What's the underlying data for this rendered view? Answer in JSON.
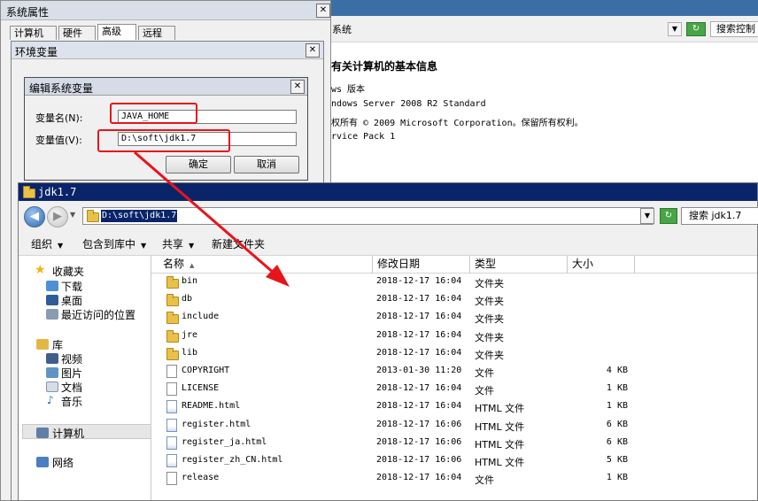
{
  "background_window": {
    "breadcrumb": "▸ 系统",
    "search_placeholder": "搜索控制",
    "heading": "有关计算机的基本信息",
    "edition_label": "ws 版本",
    "os_name": "ndows Server 2008 R2 Standard",
    "copyright": "权所有 © 2009 Microsoft Corporation。保留所有权利。",
    "service_pack": "rvice Pack 1"
  },
  "system_properties": {
    "title": "系统属性",
    "tabs": [
      "计算机名",
      "硬件",
      "高级",
      "远程"
    ],
    "active_tab": "高级"
  },
  "env_vars": {
    "title": "环境变量"
  },
  "edit_dialog": {
    "title": "编辑系统变量",
    "name_label": "变量名(N):",
    "name_value": "JAVA_HOME",
    "value_label": "变量值(V):",
    "value_value": "D:\\soft\\jdk1.7",
    "ok": "确定",
    "cancel": "取消"
  },
  "explorer": {
    "title": "jdk1.7",
    "address": "D:\\soft\\jdk1.7",
    "search_placeholder": "搜索 jdk1.7",
    "toolbar": [
      "组织",
      "包含到库中",
      "共享",
      "新建文件夹"
    ],
    "sidebar": {
      "favorites": "收藏夹",
      "downloads": "下载",
      "desktop": "桌面",
      "recent": "最近访问的位置",
      "libraries": "库",
      "videos": "视频",
      "pictures": "图片",
      "documents": "文档",
      "music": "音乐",
      "computer": "计算机",
      "network": "网络"
    },
    "columns": {
      "name": "名称",
      "modified": "修改日期",
      "type": "类型",
      "size": "大小"
    },
    "files": [
      {
        "name": "bin",
        "date": "2018-12-17 16:04",
        "type": "文件夹",
        "size": "",
        "kind": "folder"
      },
      {
        "name": "db",
        "date": "2018-12-17 16:04",
        "type": "文件夹",
        "size": "",
        "kind": "folder"
      },
      {
        "name": "include",
        "date": "2018-12-17 16:04",
        "type": "文件夹",
        "size": "",
        "kind": "folder"
      },
      {
        "name": "jre",
        "date": "2018-12-17 16:04",
        "type": "文件夹",
        "size": "",
        "kind": "folder"
      },
      {
        "name": "lib",
        "date": "2018-12-17 16:04",
        "type": "文件夹",
        "size": "",
        "kind": "folder"
      },
      {
        "name": "COPYRIGHT",
        "date": "2013-01-30 11:20",
        "type": "文件",
        "size": "4 KB",
        "kind": "file"
      },
      {
        "name": "LICENSE",
        "date": "2018-12-17 16:04",
        "type": "文件",
        "size": "1 KB",
        "kind": "file"
      },
      {
        "name": "README.html",
        "date": "2018-12-17 16:04",
        "type": "HTML 文件",
        "size": "1 KB",
        "kind": "html"
      },
      {
        "name": "register.html",
        "date": "2018-12-17 16:06",
        "type": "HTML 文件",
        "size": "6 KB",
        "kind": "html"
      },
      {
        "name": "register_ja.html",
        "date": "2018-12-17 16:06",
        "type": "HTML 文件",
        "size": "6 KB",
        "kind": "html"
      },
      {
        "name": "register_zh_CN.html",
        "date": "2018-12-17 16:06",
        "type": "HTML 文件",
        "size": "5 KB",
        "kind": "html"
      },
      {
        "name": "release",
        "date": "2018-12-17 16:04",
        "type": "文件",
        "size": "1 KB",
        "kind": "file"
      }
    ]
  },
  "colors": {
    "annotation": "#e8141b",
    "title_bar": "#0a246a",
    "folder": "#e9c04a"
  }
}
